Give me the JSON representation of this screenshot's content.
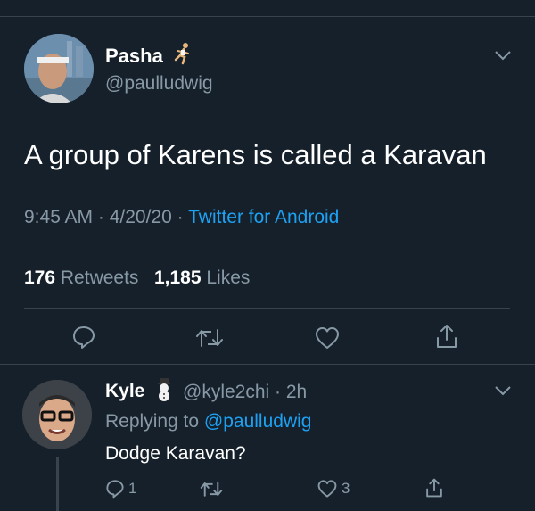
{
  "tweet": {
    "author_name": "Pasha",
    "author_emoji": "running-person-emoji",
    "author_handle": "@paulludwig",
    "text": "A group of Karens is called a Karavan",
    "time": "9:45 AM",
    "date": "4/20/20",
    "source": "Twitter for Android",
    "retweets_count": "176",
    "retweets_label": "Retweets",
    "likes_count": "1,185",
    "likes_label": "Likes"
  },
  "reply": {
    "author_name": "Kyle",
    "author_emoji": "snowman-emoji",
    "author_handle": "@kyle2chi",
    "age": "2h",
    "replying_to_label": "Replying to",
    "replying_to_handle": "@paulludwig",
    "text": "Dodge Karavan?",
    "reply_count": "1",
    "like_count": "3"
  },
  "colors": {
    "background": "#15202b",
    "accent": "#1da1f2",
    "secondary_text": "#8899a6",
    "divider": "#38444d"
  },
  "icons": [
    "reply-icon",
    "retweet-icon",
    "like-icon",
    "share-icon",
    "chevron-down-icon"
  ]
}
